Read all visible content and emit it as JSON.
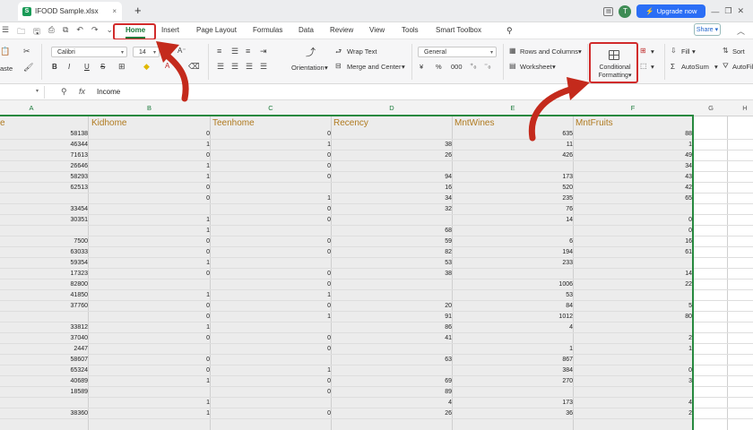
{
  "window": {
    "file_name": "IFOOD Sample.xlsx",
    "close_glyph": "×",
    "new_tab_glyph": "+",
    "avatar_initial": "T",
    "upgrade_label": "Upgrade now",
    "min_glyph": "—",
    "max_glyph": "❐",
    "close_win_glyph": "✕"
  },
  "menu": {
    "tabs": [
      "Home",
      "Insert",
      "Page Layout",
      "Formulas",
      "Data",
      "Review",
      "View",
      "Tools",
      "Smart Toolbox"
    ],
    "active_tab": "Home",
    "share_label": "Share",
    "share_dd": "▾",
    "collapse_glyph": "︿"
  },
  "ribbon": {
    "paste_label": "aste",
    "font_name": "Calibri",
    "font_size": "14",
    "dd": "▾",
    "bold": "B",
    "italic": "I",
    "underline": "U",
    "strike": "S",
    "orientation_label": "Orientation",
    "wrap_text_label": "Wrap Text",
    "merge_center_label": "Merge and Center",
    "number_format": "General",
    "rows_columns_label": "Rows and Columns",
    "worksheet_label": "Worksheet",
    "cond_format_line1": "Conditional",
    "cond_format_line2": "Formatting",
    "fill_label": "Fill",
    "autosum_label": "AutoSum",
    "sort_label": "Sort",
    "autofilter_label": "AutoFil",
    "currency_symbol": "¥",
    "percent_symbol": "%",
    "thousands_symbol": "000",
    "sigma_symbol": "Σ",
    "accent_green": "#1a7a3a",
    "highlight_red": "#d12b2b"
  },
  "formula_bar": {
    "fx": "fx",
    "search_glyph": "⚲",
    "value": "Income"
  },
  "sheet": {
    "column_letters": [
      "A",
      "B",
      "C",
      "D",
      "E",
      "F",
      "G",
      "H"
    ],
    "headers": {
      "income": "e",
      "kidhome": "Kidhome",
      "teenhome": "Teenhome",
      "recency": "Recency",
      "mntwines": "MntWines",
      "mntfruits": "MntFruits"
    },
    "rows": [
      [
        "58138",
        "0",
        "0",
        "",
        "635",
        "88"
      ],
      [
        "46344",
        "1",
        "1",
        "38",
        "11",
        "1"
      ],
      [
        "71613",
        "0",
        "0",
        "26",
        "426",
        "49"
      ],
      [
        "26646",
        "1",
        "0",
        "",
        "",
        "34"
      ],
      [
        "58293",
        "1",
        "0",
        "94",
        "173",
        "43"
      ],
      [
        "62513",
        "0",
        "",
        "16",
        "520",
        "42"
      ],
      [
        "",
        "0",
        "1",
        "34",
        "235",
        "65"
      ],
      [
        "33454",
        "",
        "0",
        "32",
        "76",
        ""
      ],
      [
        "30351",
        "1",
        "0",
        "",
        "14",
        "0"
      ],
      [
        "",
        "1",
        "",
        "68",
        "",
        "0"
      ],
      [
        "7500",
        "0",
        "0",
        "59",
        "6",
        "16"
      ],
      [
        "63033",
        "0",
        "0",
        "82",
        "194",
        "61"
      ],
      [
        "59354",
        "1",
        "",
        "53",
        "233",
        ""
      ],
      [
        "17323",
        "0",
        "0",
        "38",
        "",
        "14"
      ],
      [
        "82800",
        "",
        "0",
        "",
        "1006",
        "22"
      ],
      [
        "41850",
        "1",
        "1",
        "",
        "53",
        ""
      ],
      [
        "37760",
        "0",
        "0",
        "20",
        "84",
        "5"
      ],
      [
        "",
        "0",
        "1",
        "91",
        "1012",
        "80"
      ],
      [
        "33812",
        "1",
        "",
        "86",
        "4",
        ""
      ],
      [
        "37040",
        "0",
        "0",
        "41",
        "",
        "2"
      ],
      [
        "2447",
        "",
        "0",
        "",
        "1",
        "1"
      ],
      [
        "58607",
        "0",
        "",
        "63",
        "867",
        ""
      ],
      [
        "65324",
        "0",
        "1",
        "",
        "384",
        "0"
      ],
      [
        "40689",
        "1",
        "0",
        "69",
        "270",
        "3"
      ],
      [
        "18589",
        "",
        "0",
        "89",
        "",
        ""
      ],
      [
        "",
        "1",
        "",
        "4",
        "173",
        "4"
      ],
      [
        "38360",
        "1",
        "0",
        "26",
        "36",
        "2"
      ]
    ]
  }
}
